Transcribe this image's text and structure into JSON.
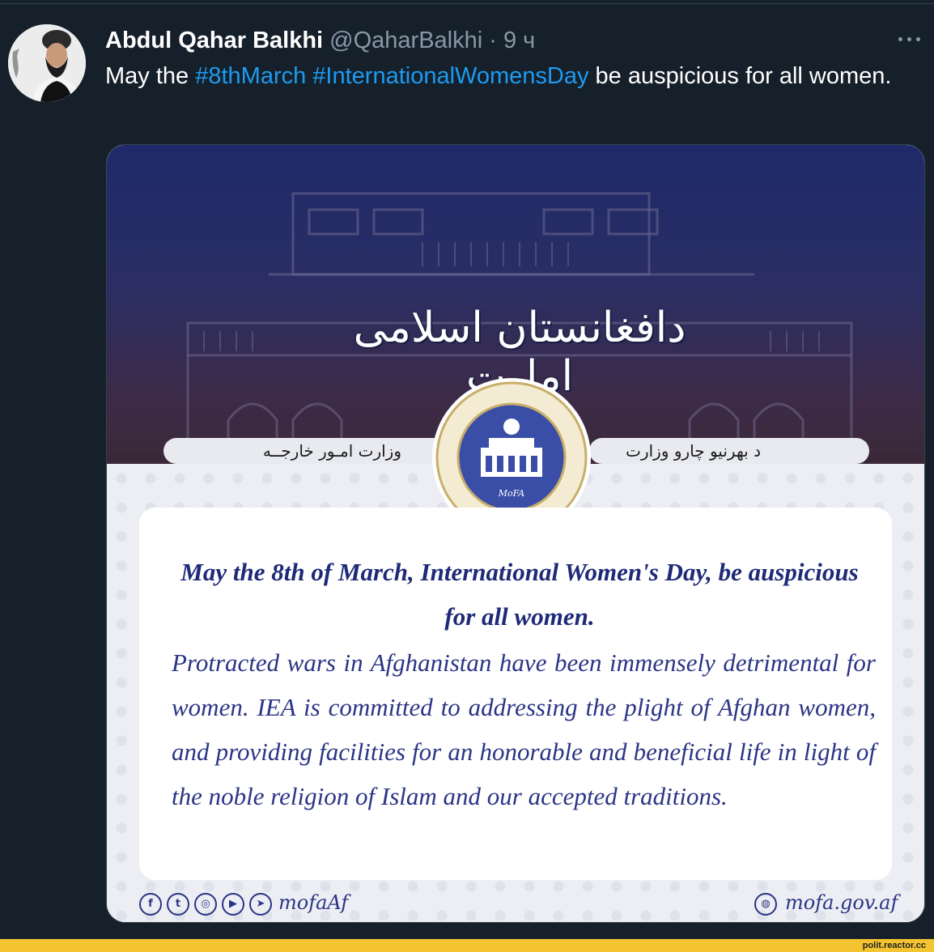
{
  "tweet": {
    "author_name": "Abdul Qahar Balkhi",
    "handle": "@QaharBalkhi",
    "separator": "·",
    "time": "9 ч",
    "text_prefix": "May the ",
    "hashtag_1": "#8thMarch",
    "hashtag_2": "#InternationalWomensDay",
    "text_suffix": " be auspicious for all women."
  },
  "image": {
    "emirate_title": "دافغانستان اسلامی امارت",
    "pill_left": "وزارت امـور خارجــه",
    "pill_right": "د بهرنیو چارو وزارت",
    "seal_label": "MoFA",
    "headline": "May the 8th of March, International Women's Day, be auspicious for all women.",
    "body": "Protracted wars in Afghanistan have been immensely detrimental for women. IEA is committed to addressing the plight of Afghan women, and providing facilities for an honorable and beneficial life in light of the noble religion of Islam and our accepted traditions.",
    "social_handle": "mofaAf",
    "website": "mofa.gov.af"
  },
  "icons": [
    "facebook-icon",
    "twitter-icon",
    "instagram-icon",
    "youtube-icon",
    "telegram-icon",
    "globe-icon",
    "more-icon"
  ],
  "watermark": "polit.reactor.cc",
  "colors": {
    "background": "#15202b",
    "hashtag": "#1d9bf0",
    "muted": "#8899a6",
    "navy_text": "#2a3585",
    "banner_bar": "#f4c430"
  }
}
